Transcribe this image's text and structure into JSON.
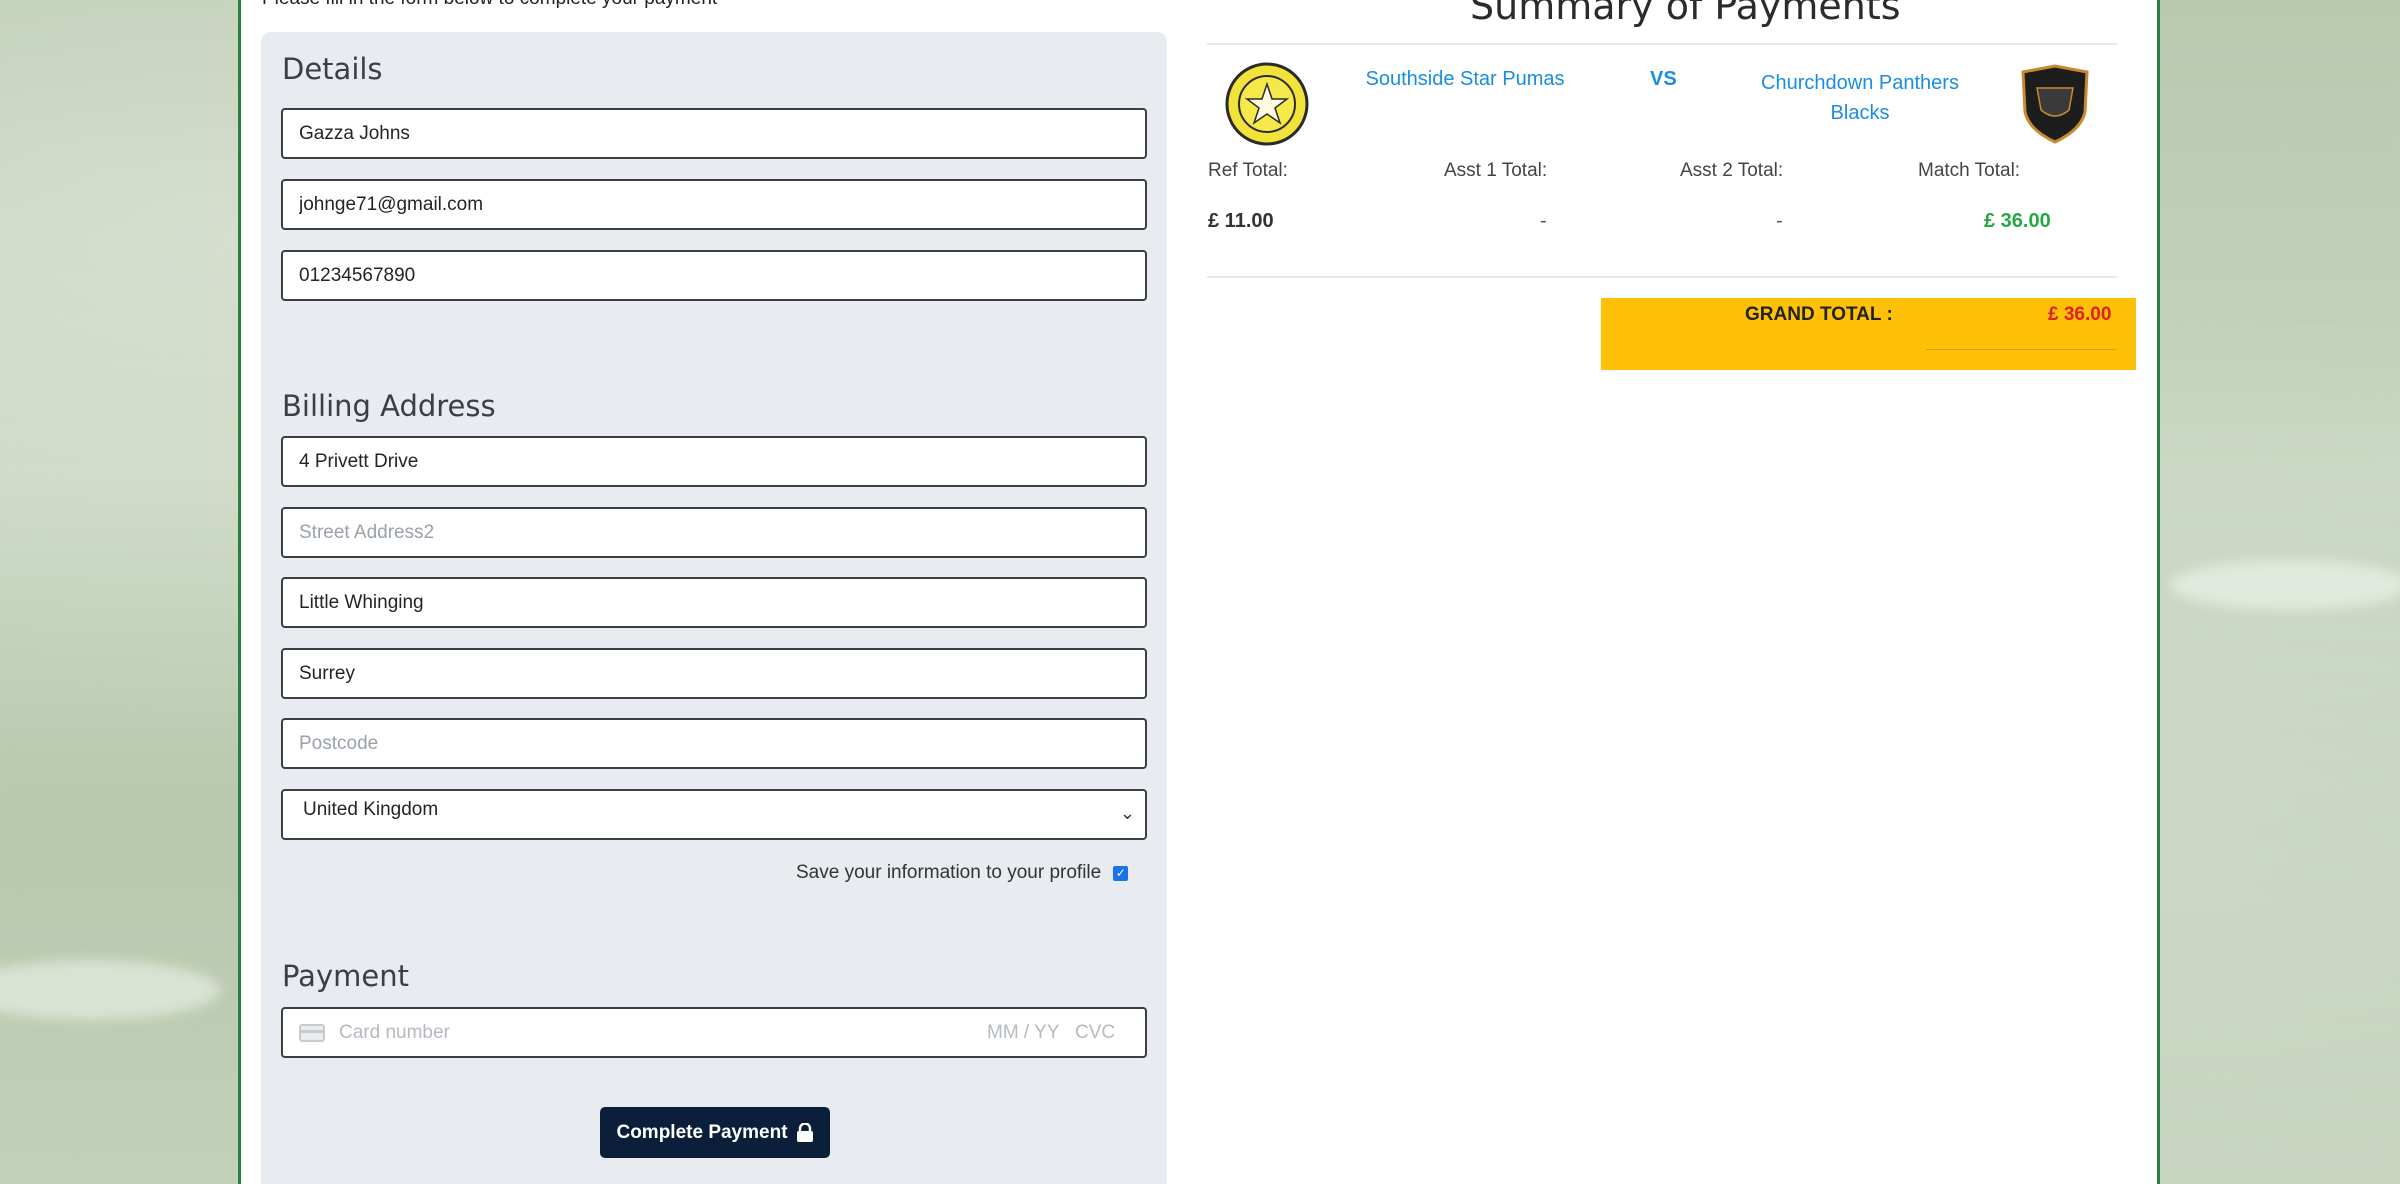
{
  "intro": {
    "text": "Please fill in the form below to complete your payment"
  },
  "details": {
    "heading": "Details",
    "name_value": "Gazza Johns",
    "email_value": "johnge71@gmail.com",
    "phone_value": "01234567890"
  },
  "billing": {
    "heading": "Billing Address",
    "street1_value": "4 Privett Drive",
    "street2_placeholder": "Street Address2",
    "city_value": "Little Whinging",
    "county_value": "Surrey",
    "postcode_placeholder": "Postcode",
    "country_selected": "United Kingdom",
    "save_label": "Save your information to your profile",
    "save_checked": true
  },
  "payment": {
    "heading": "Payment",
    "card_placeholder": "Card number",
    "expiry_placeholder": "MM / YY",
    "cvc_placeholder": "CVC",
    "button_label": "Complete Payment"
  },
  "summary": {
    "title": "Summary of Payments",
    "home_team": "Southside Star Pumas",
    "vs": "VS",
    "away_team_line1": "Churchdown Panthers",
    "away_team_line2": "Blacks",
    "columns": {
      "ref_label": "Ref Total:",
      "asst1_label": "Asst 1 Total:",
      "asst2_label": "Asst 2 Total:",
      "match_label": "Match Total:"
    },
    "values": {
      "ref": "£ 11.00",
      "asst1": "-",
      "asst2": "-",
      "match": "£ 36.00"
    },
    "grand_total_label": "GRAND TOTAL :",
    "grand_total_value": "£ 36.00",
    "colors": {
      "link": "#1a8de1",
      "match_total": "#28a745",
      "grand_total": "#e0201b",
      "grand_box": "#ffc107"
    }
  }
}
